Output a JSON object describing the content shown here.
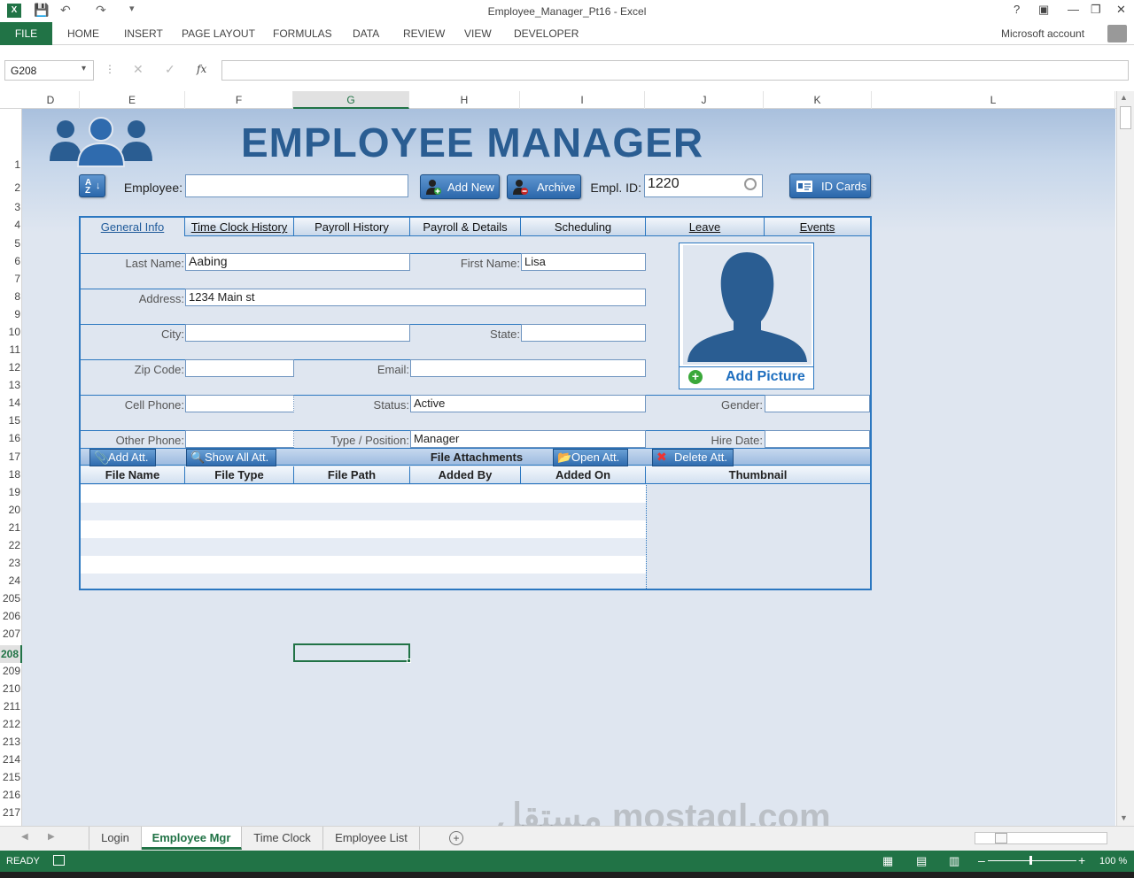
{
  "window": {
    "title": "Employee_Manager_Pt16 - Excel",
    "account": "Microsoft account"
  },
  "ribbon": {
    "file": "FILE",
    "tabs": [
      "HOME",
      "INSERT",
      "PAGE LAYOUT",
      "FORMULAS",
      "DATA",
      "REVIEW",
      "VIEW",
      "DEVELOPER"
    ]
  },
  "formula_bar": {
    "name_box": "G208",
    "fx": "fx",
    "formula": ""
  },
  "columns": [
    "D",
    "E",
    "F",
    "G",
    "H",
    "I",
    "J",
    "K",
    "L"
  ],
  "rows": [
    "1",
    "2",
    "3",
    "4",
    "5",
    "6",
    "7",
    "8",
    "9",
    "10",
    "11",
    "12",
    "13",
    "14",
    "15",
    "16",
    "17",
    "18",
    "19",
    "20",
    "21",
    "22",
    "23",
    "24",
    "205",
    "206",
    "207",
    "208",
    "209",
    "210",
    "211",
    "212",
    "213",
    "214",
    "215",
    "216",
    "217"
  ],
  "form": {
    "title": "EMPLOYEE MANAGER",
    "employee_label": "Employee:",
    "employee_value": "",
    "add_new": "Add New",
    "archive": "Archive",
    "empl_id_label": "Empl. ID:",
    "empl_id_value": "1220",
    "id_cards": "ID Cards",
    "tabs": [
      "General Info",
      "Time Clock History",
      "Payroll History",
      "Payroll & Details",
      "Scheduling",
      "Leave",
      "Events"
    ],
    "last_name_label": "Last Name:",
    "last_name": "Aabing",
    "first_name_label": "First Name:",
    "first_name": "Lisa",
    "address_label": "Address:",
    "address": "1234 Main st",
    "city_label": "City:",
    "city": "",
    "state_label": "State:",
    "state": "",
    "zip_label": "Zip Code:",
    "zip": "",
    "email_label": "Email:",
    "email": "",
    "cell_label": "Cell Phone:",
    "cell": "",
    "status_label": "Status:",
    "status": "Active",
    "gender_label": "Gender:",
    "gender": "",
    "other_phone_label": "Other Phone:",
    "other_phone": "",
    "type_label": "Type / Position:",
    "type": "Manager",
    "hire_label": "Hire Date:",
    "hire": "",
    "add_picture": "Add Picture",
    "attachments": {
      "title": "File Attachments",
      "add": "Add Att.",
      "show_all": "Show All Att.",
      "open": "Open Att.",
      "delete": "Delete Att.",
      "headers": [
        "File Name",
        "File Type",
        "File Path",
        "Added By",
        "Added On",
        "Thumbnail"
      ]
    }
  },
  "sheet_tabs": [
    "Login",
    "Employee Mgr",
    "Time Clock",
    "Employee List"
  ],
  "active_sheet": "Employee Mgr",
  "status": {
    "ready": "READY",
    "zoom": "100 %"
  },
  "watermark": "مستقل mostaql.com",
  "colors": {
    "excel_green": "#217346",
    "title_blue": "#2a5d92",
    "border_blue": "#2b77c0"
  }
}
